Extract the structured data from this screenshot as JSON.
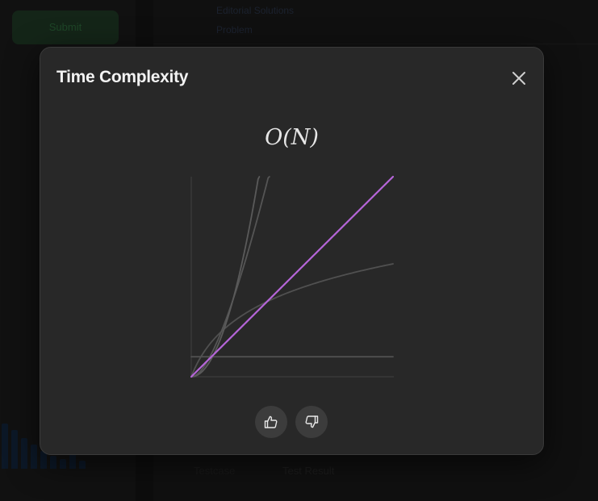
{
  "background": {
    "submit_label": "Submit",
    "top_text_1": "Editorial  Solutions",
    "top_text_2": "Problem",
    "bottom_text_1": "Testcase",
    "bottom_text_2": "Test Result"
  },
  "modal": {
    "title": "Time Complexity",
    "complexity": "O(N)",
    "close_icon": "close-icon",
    "upvote_icon": "thumbs-up-icon",
    "downvote_icon": "thumbs-down-icon"
  },
  "chart_data": {
    "type": "line",
    "title": "O(N)",
    "xlabel": "",
    "ylabel": "",
    "grid": false,
    "legend": "none",
    "xlim": [
      0,
      10
    ],
    "ylim": [
      0,
      10
    ],
    "series": [
      {
        "highlighted": false,
        "color": "#505050",
        "kind": "constant"
      },
      {
        "highlighted": false,
        "color": "#505050",
        "kind": "logarithmic"
      },
      {
        "highlighted": true,
        "color": "#b565d8",
        "kind": "linear"
      },
      {
        "highlighted": false,
        "color": "#555555",
        "kind": "linearithmic"
      },
      {
        "highlighted": false,
        "color": "#5a5a5a",
        "kind": "quadratic"
      }
    ]
  }
}
